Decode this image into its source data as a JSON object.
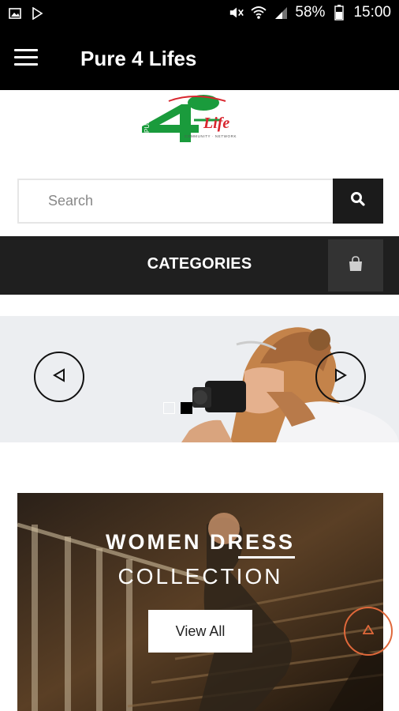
{
  "status_bar": {
    "battery": "58%",
    "time": "15:00"
  },
  "app_bar": {
    "title": "Pure 4 Lifes"
  },
  "logo": {
    "text": "Life"
  },
  "search": {
    "placeholder": "Search"
  },
  "categories": {
    "label": "CATEGORIES"
  },
  "slider": {
    "slide_count": 2,
    "active_index": 1
  },
  "banner": {
    "title_line1": "WOMEN DRESS",
    "title_line2": "COLLECTION",
    "button_label": "View All"
  },
  "colors": {
    "app_bar": "#000000",
    "categories_bar": "#1f1f1f",
    "scroll_top_accent": "#e0683a",
    "logo_green": "#1a9b3c",
    "logo_red": "#d8262e"
  }
}
